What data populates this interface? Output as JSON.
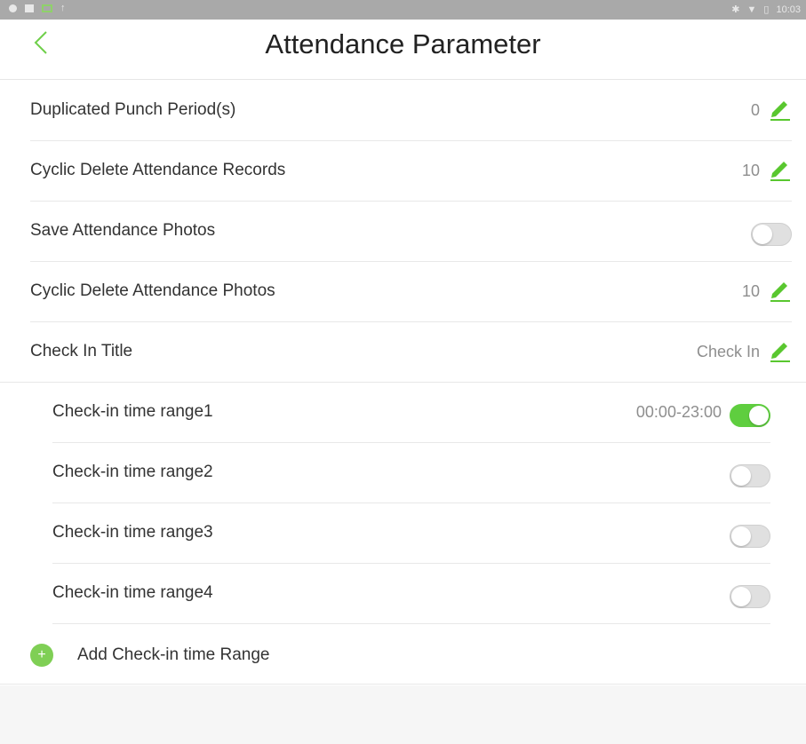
{
  "status_bar": {
    "time": "10:03"
  },
  "header": {
    "title": "Attendance Parameter"
  },
  "rows": [
    {
      "label": "Duplicated Punch Period(s)",
      "value": "0"
    },
    {
      "label": "Cyclic Delete Attendance Records",
      "value": "10"
    },
    {
      "label": "Save Attendance Photos",
      "toggle": false
    },
    {
      "label": "Cyclic Delete Attendance Photos",
      "value": "10"
    },
    {
      "label": "Check In Title",
      "value": "Check In"
    }
  ],
  "time_ranges": [
    {
      "label": "Check-in time range1",
      "value": "00:00-23:00",
      "enabled": true
    },
    {
      "label": "Check-in time range2",
      "enabled": false
    },
    {
      "label": "Check-in time range3",
      "enabled": false
    },
    {
      "label": "Check-in time range4",
      "enabled": false
    }
  ],
  "add_range": {
    "label": "Add Check-in time Range",
    "icon": "plus-icon"
  },
  "colors": {
    "accent": "#5fce3f",
    "edit_icon": "#59c72f",
    "status_bar": "#a9a9a9"
  }
}
